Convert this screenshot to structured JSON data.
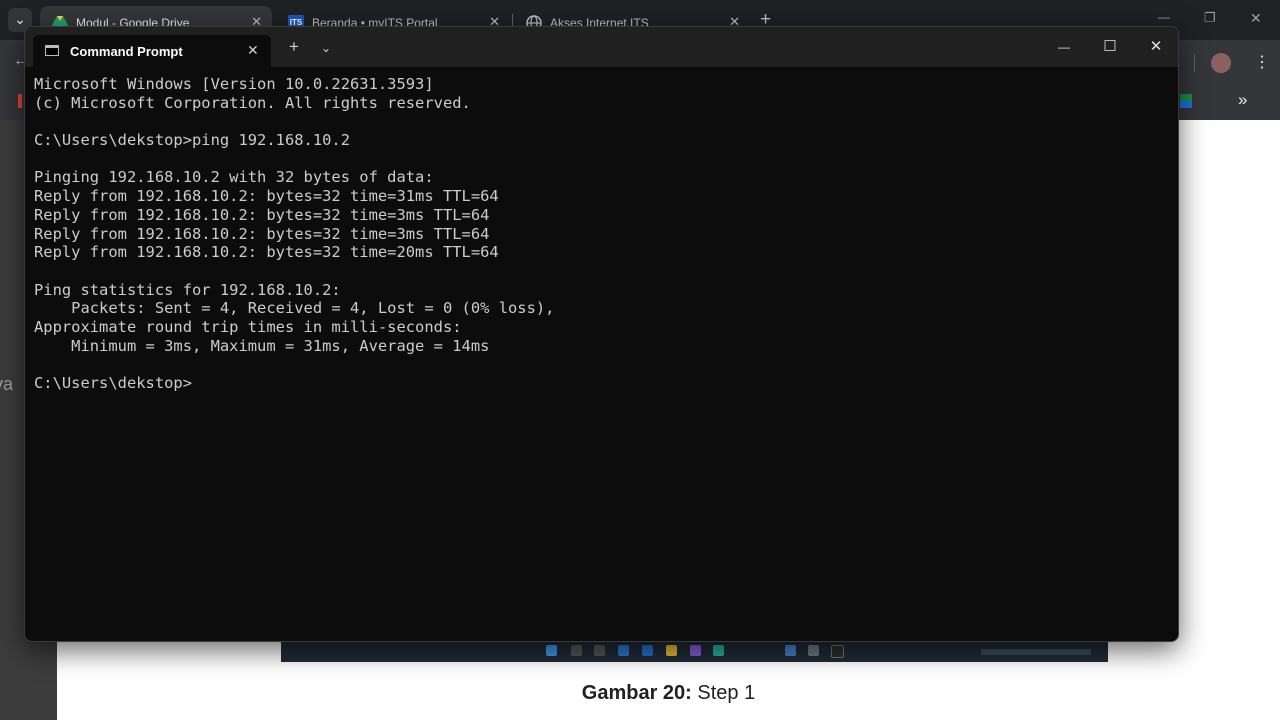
{
  "browser": {
    "tabs": [
      {
        "label": "Modul - Google Drive",
        "icon": "google-drive-icon",
        "active": true
      },
      {
        "label": "Beranda • myITS Portal",
        "icon": "its-icon",
        "active": false
      },
      {
        "label": "Akses Internet ITS",
        "icon": "globe-icon",
        "active": false
      }
    ],
    "tab_close_glyph": "✕",
    "new_tab_glyph": "+",
    "tab_search_glyph": "⌄",
    "back_glyph": "←",
    "more_glyph": "»",
    "menu_glyph": "⋮",
    "window_controls": {
      "minimize": "—",
      "restore": "❐",
      "close": "✕"
    }
  },
  "document": {
    "caption_bold": "Gambar 20:",
    "caption_text": " Step 1",
    "side_text": "va"
  },
  "terminal": {
    "tab_title": "Command Prompt",
    "tab_close": "✕",
    "new_tab": "+",
    "dropdown": "⌄",
    "controls": {
      "minimize": "—",
      "maximize": "☐",
      "close": "✕"
    },
    "lines": [
      "Microsoft Windows [Version 10.0.22631.3593]",
      "(c) Microsoft Corporation. All rights reserved.",
      "",
      "C:\\Users\\dekstop>ping 192.168.10.2",
      "",
      "Pinging 192.168.10.2 with 32 bytes of data:",
      "Reply from 192.168.10.2: bytes=32 time=31ms TTL=64",
      "Reply from 192.168.10.2: bytes=32 time=3ms TTL=64",
      "Reply from 192.168.10.2: bytes=32 time=3ms TTL=64",
      "Reply from 192.168.10.2: bytes=32 time=20ms TTL=64",
      "",
      "Ping statistics for 192.168.10.2:",
      "    Packets: Sent = 4, Received = 4, Lost = 0 (0% loss),",
      "Approximate round trip times in milli-seconds:",
      "    Minimum = 3ms, Maximum = 31ms, Average = 14ms",
      "",
      "C:\\Users\\dekstop>"
    ]
  },
  "colors": {
    "terminal_bg": "#0c0c0c",
    "terminal_text": "#cccccc",
    "titlebar_bg": "#202020",
    "browser_frame": "#202124",
    "drive_icon": "#1fa463",
    "its_icon": "#1a56b8"
  }
}
